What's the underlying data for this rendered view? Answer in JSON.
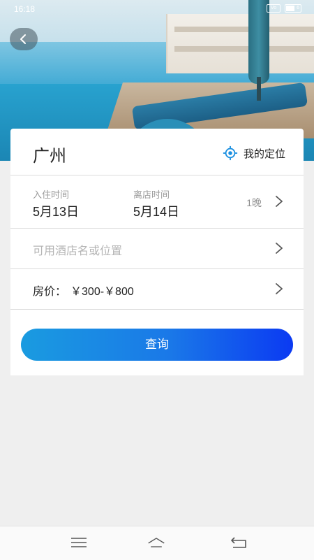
{
  "status_bar": {
    "time": "16:18",
    "signal": "Vo",
    "battery": "6"
  },
  "header": {
    "back_icon": "chevron-left-icon"
  },
  "search": {
    "city": "广州",
    "my_location_label": "我的定位",
    "locate_icon": "location-target-icon",
    "checkin_label": "入住时间",
    "checkin_date": "5月13日",
    "checkout_label": "离店时间",
    "checkout_date": "5月14日",
    "nights": "1晚",
    "hotel_placeholder": "可用酒店名或位置",
    "price_label": "房价：",
    "price_range": "￥300-￥800",
    "query_button": "查询"
  },
  "navbar": {
    "menu_icon": "menu-icon",
    "home_icon": "home-icon",
    "back_icon": "back-arrow-icon"
  },
  "colors": {
    "accent_start": "#1a9be0",
    "accent_end": "#0b3af2",
    "locate_icon": "#1a8fe0",
    "background": "#efefef"
  }
}
